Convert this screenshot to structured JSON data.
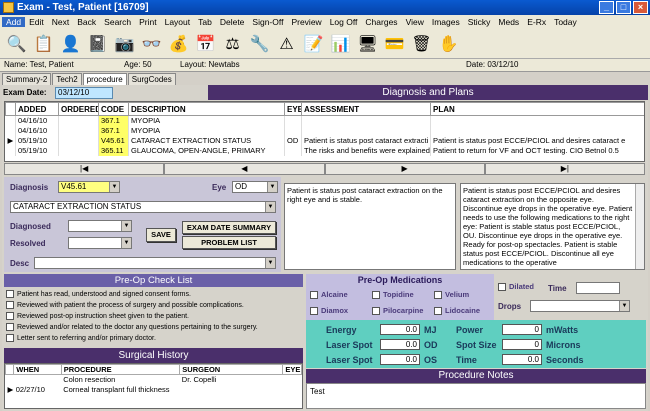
{
  "window": {
    "title": "Exam - Test, Patient [16709]"
  },
  "menu": [
    "Add",
    "Edit",
    "Next",
    "Back",
    "Search",
    "Print",
    "Layout",
    "Tab",
    "Delete",
    "Sign-Off",
    "Preview",
    "Log Off",
    "Charges",
    "View",
    "Images",
    "Sticky",
    "Meds",
    "E-Rx",
    "Today"
  ],
  "toolbar_icons": [
    "search-icon",
    "prescription-icon",
    "patient-icon",
    "notebook-icon",
    "camera-icon",
    "glasses-icon",
    "money-icon",
    "calendar-icon",
    "scales-icon",
    "tools-icon",
    "warning-icon",
    "note-icon",
    "chart-icon",
    "monitor-icon",
    "card-icon",
    "trash-icon",
    "hand-icon"
  ],
  "info": {
    "name": "Name: Test, Patient",
    "age": "Age: 50",
    "layout": "Layout: Newtabs",
    "date": "Date: 03/12/10"
  },
  "tabs": [
    "Summary-2",
    "Tech2",
    "procedure",
    "SurgCodes"
  ],
  "exam_date": {
    "label": "Exam Date:",
    "value": "03/12/10"
  },
  "dx_header": "Diagnosis and Plans",
  "grid": {
    "columns": [
      "ADDED",
      "ORDERED",
      "CODE",
      "DESCRIPTION",
      "EYE",
      "ASSESSMENT",
      "PLAN"
    ],
    "rows": [
      {
        "added": "04/16/10",
        "ordered": "",
        "code": "367.1",
        "desc": "MYOPIA",
        "eye": "",
        "assess": "",
        "plan": ""
      },
      {
        "added": "04/16/10",
        "ordered": "",
        "code": "367.1",
        "desc": "MYOPIA",
        "eye": "",
        "assess": "",
        "plan": ""
      },
      {
        "added": "05/19/10",
        "ordered": "",
        "code": "V45.61",
        "desc": "CATARACT EXTRACTION STATUS",
        "eye": "OD",
        "assess": "Patient is status post cataract extracti",
        "plan": "Patient is status post ECCE/PCIOL and desires cataract e"
      },
      {
        "added": "05/19/10",
        "ordered": "",
        "code": "365.11",
        "desc": "GLAUCOMA, OPEN-ANGLE, PRIMARY",
        "eye": "",
        "assess": "The risks and benefits were explained",
        "plan": "Patient to return for VF and OCT testing. CIO Betnol 0.5"
      }
    ]
  },
  "nav": [
    "|◀",
    "◀",
    "▶",
    "▶|"
  ],
  "dx": {
    "diagnosis_label": "Diagnosis",
    "diagnosis_value": "V45.61",
    "eye_label": "Eye",
    "eye_value": "OD",
    "desc_value": "CATARACT EXTRACTION STATUS",
    "diagnosed_label": "Diagnosed",
    "resolved_label": "Resolved",
    "desc_label": "Desc",
    "save": "SAVE",
    "exam_date_summary": "EXAM DATE SUMMARY",
    "problem_list": "PROBLEM LIST",
    "assessment_text": "Patient is status post cataract extraction on the right eye and is stable.",
    "plan_text": "Patient is status post ECCE/PCIOL and desires cataract extraction on the opposite eye. Discontinue eye drops in the operative eye. Patient needs to use the following medications to the right eye: Patient is stable status post ECCE/PCIOL, OU.  Discontinue eye drops in the operative eye.  Ready for post-op spectacles. Patient is stable status post ECCE/PCIOL. Discontinue all eye medications to the operative"
  },
  "preop": {
    "title": "Pre-Op Check List",
    "items": [
      "Patient has read, understood and signed consent forms.",
      "Reviewed with patient the process of surgery and possible complications.",
      "Reviewed post-op instruction sheet given to the patient.",
      "Reviewed and/or related to the doctor any questions pertaining to the surgery.",
      "Letter sent to referring and/or primary doctor."
    ]
  },
  "surgical": {
    "title": "Surgical History",
    "columns": [
      "WHEN",
      "PROCEDURE",
      "SURGEON",
      "EYE"
    ],
    "rows": [
      {
        "when": "",
        "proc": "Colon resection",
        "surgeon": "Dr. Copelli",
        "eye": ""
      },
      {
        "when": "02/27/10",
        "proc": "Corneal transplant full thickness",
        "surgeon": "",
        "eye": ""
      }
    ]
  },
  "meds": {
    "title": "Pre-Op Medications",
    "items": [
      "Alcaine",
      "Diamox",
      "Topidine",
      "Pilocarpine",
      "Velium",
      "Lidocaine"
    ]
  },
  "dilated": {
    "dilated_label": "Dilated",
    "time_label": "Time",
    "drops_label": "Drops"
  },
  "laser": {
    "energy": "Energy",
    "energy_val": "0.0",
    "energy_unit": "MJ",
    "laser1": "Laser Spot",
    "laser1_val": "0.0",
    "laser1_unit": "OD",
    "laser2": "Laser Spot",
    "laser2_val": "0.0",
    "laser2_unit": "OS",
    "power": "Power",
    "power_val": "0",
    "power_unit": "mWatts",
    "spot": "Spot Size",
    "spot_val": "0",
    "spot_unit": "Microns",
    "time": "Time",
    "time_val": "0.0",
    "time_unit": "Seconds"
  },
  "notes": {
    "title": "Procedure Notes",
    "text": "Test"
  }
}
